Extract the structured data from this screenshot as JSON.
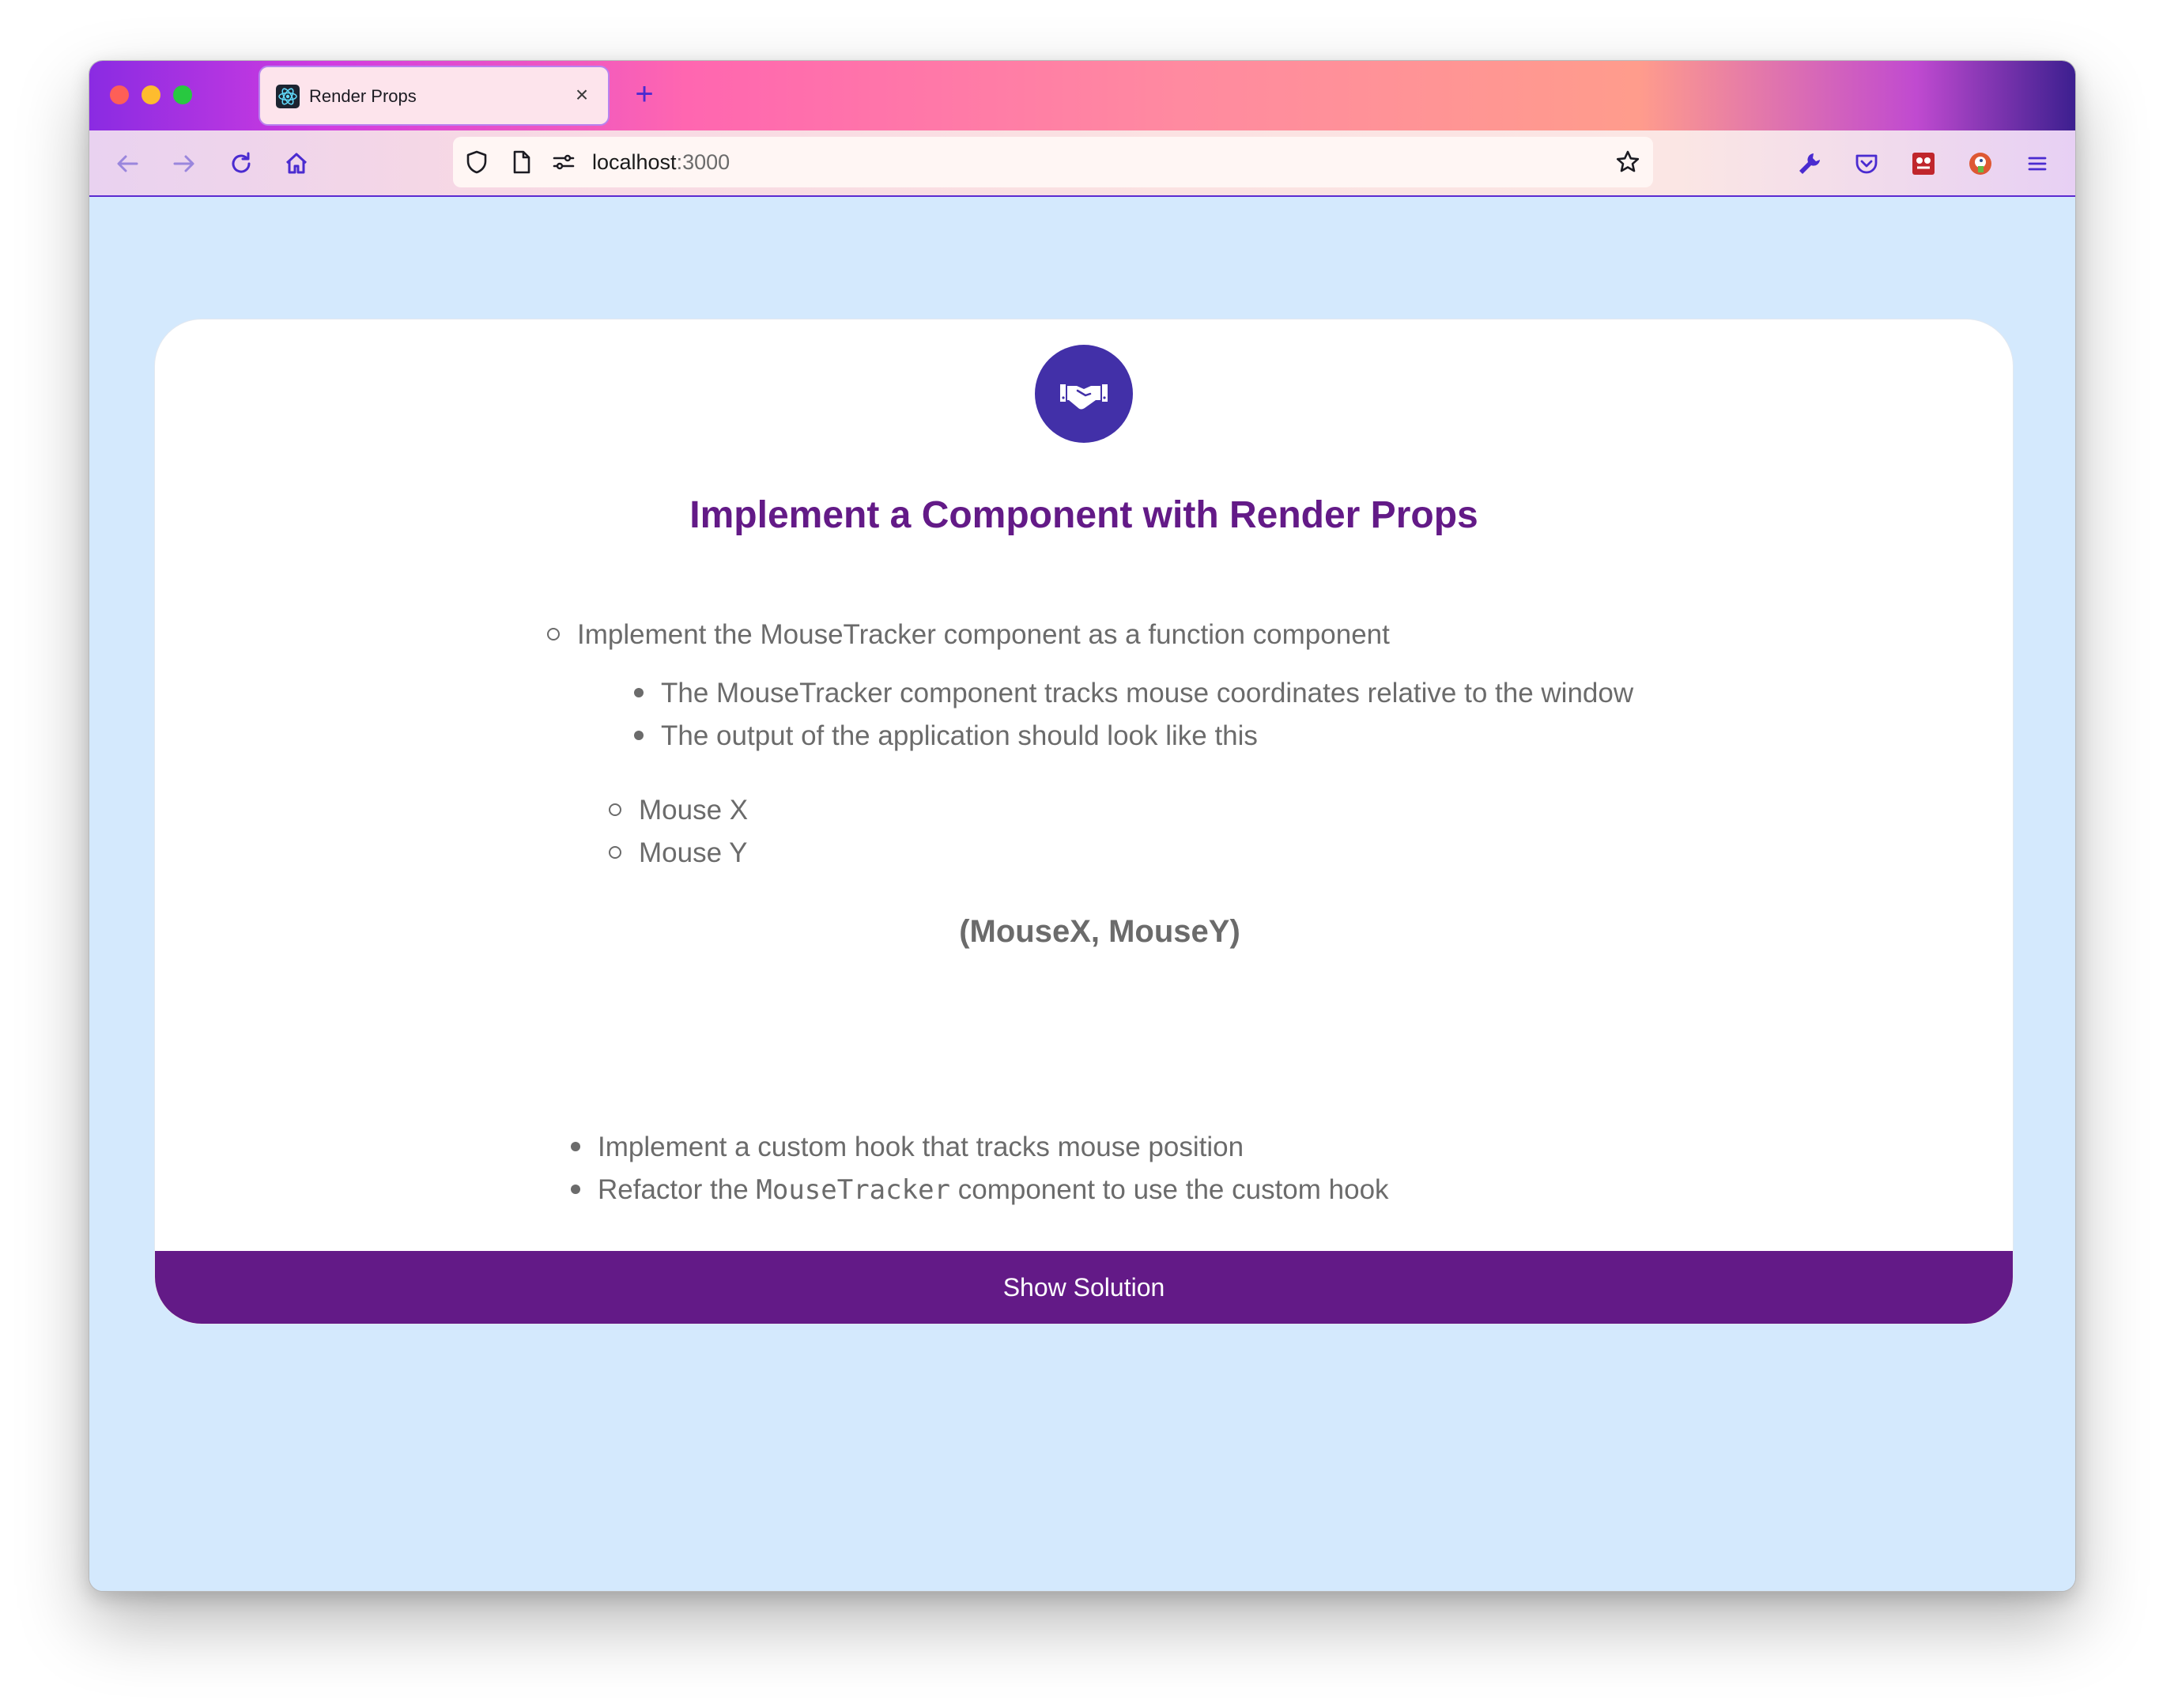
{
  "browser": {
    "tab_title": "Render Props",
    "url_host": "localhost",
    "url_port": ":3000",
    "new_tab_symbol": "+",
    "close_symbol": "×"
  },
  "card": {
    "title": "Implement a Component with Render Props",
    "icon": "handshake-icon",
    "tasks": {
      "main": "Implement the MouseTracker component as a function component",
      "sub": [
        "The MouseTracker component tracks mouse coordinates relative to the window",
        "The output of the application should look like this"
      ],
      "output_items": [
        "Mouse X",
        "Mouse Y"
      ],
      "coords_text": "(MouseX, MouseY)",
      "extra": [
        "Implement a custom hook that tracks mouse position"
      ],
      "refactor_prefix": "Refactor the ",
      "refactor_code": "MouseTracker",
      "refactor_suffix": " component to use the custom hook"
    },
    "button_label": "Show Solution"
  },
  "colors": {
    "accent": "#631a87",
    "icon_bg": "#4230a8",
    "page_bg": "#d4e9fd"
  }
}
